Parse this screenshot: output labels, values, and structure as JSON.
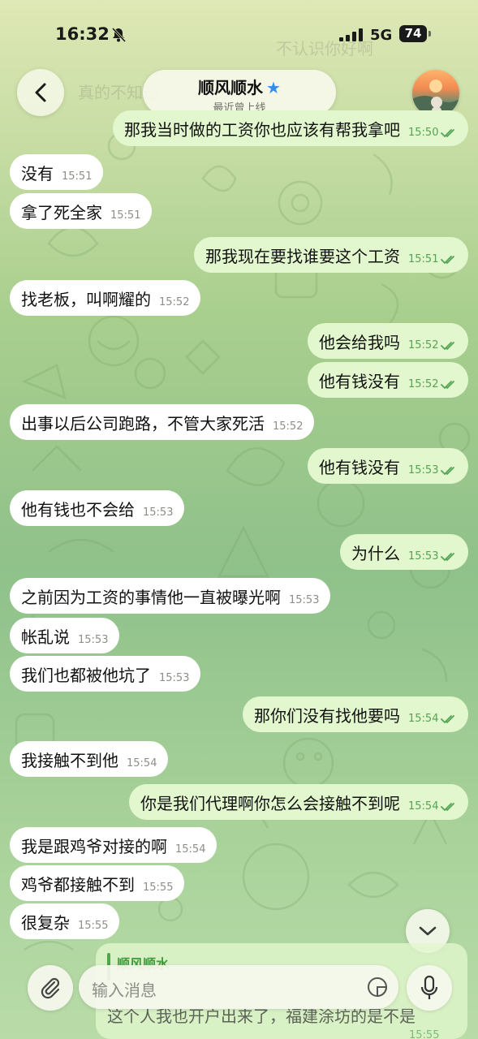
{
  "status_bar": {
    "time": "16:32",
    "network": "5G",
    "battery": "74"
  },
  "header": {
    "title": "顺风顺水",
    "subtitle": "最近曾上线",
    "star_icon": "star-icon",
    "back_icon": "chevron-left-icon"
  },
  "ghost_messages": [
    "不认识你好啊",
    "真的不知道"
  ],
  "messages": [
    {
      "dir": "out",
      "text": "那我当时做的工资你也应该有帮我拿吧",
      "time": "15:50"
    },
    {
      "dir": "in",
      "text": "没有",
      "time": "15:51"
    },
    {
      "dir": "in",
      "text": "拿了死全家",
      "time": "15:51"
    },
    {
      "dir": "out",
      "text": "那我现在要找谁要这个工资",
      "time": "15:51"
    },
    {
      "dir": "in",
      "text": "找老板，叫啊耀的",
      "time": "15:52"
    },
    {
      "dir": "out",
      "text": "他会给我吗",
      "time": "15:52"
    },
    {
      "dir": "out",
      "text": "他有钱没有",
      "time": "15:52"
    },
    {
      "dir": "in",
      "text": "出事以后公司跑路，不管大家死活",
      "time": "15:52"
    },
    {
      "dir": "out",
      "text": "他有钱没有",
      "time": "15:53"
    },
    {
      "dir": "in",
      "text": "他有钱也不会给",
      "time": "15:53"
    },
    {
      "dir": "out",
      "text": "为什么",
      "time": "15:53"
    },
    {
      "dir": "in",
      "text": "之前因为工资的事情他一直被曝光啊",
      "time": "15:53"
    },
    {
      "dir": "in",
      "text": "帐乱说",
      "time": "15:53"
    },
    {
      "dir": "in",
      "text": "我们也都被他坑了",
      "time": "15:53"
    },
    {
      "dir": "out",
      "text": "那你们没有找他要吗",
      "time": "15:54"
    },
    {
      "dir": "in",
      "text": "我接触不到他",
      "time": "15:54"
    },
    {
      "dir": "out",
      "text": "你是我们代理啊你怎么会接触不到呢",
      "time": "15:54"
    },
    {
      "dir": "in",
      "text": "我是跟鸡爷对接的啊",
      "time": "15:54"
    },
    {
      "dir": "in",
      "text": "鸡爷都接触不到",
      "time": "15:55"
    },
    {
      "dir": "in",
      "text": "很复杂",
      "time": "15:55"
    }
  ],
  "quote_preview": {
    "name": "顺风顺水",
    "text": "这个人我也开户出来了，福建涂坊的是不是",
    "time": "15:55"
  },
  "composer": {
    "placeholder": "输入消息"
  },
  "colors": {
    "incoming": "#ffffff",
    "outgoing": "#e2f7cd",
    "accent": "#4ca84a",
    "star": "#2f8ff0"
  }
}
